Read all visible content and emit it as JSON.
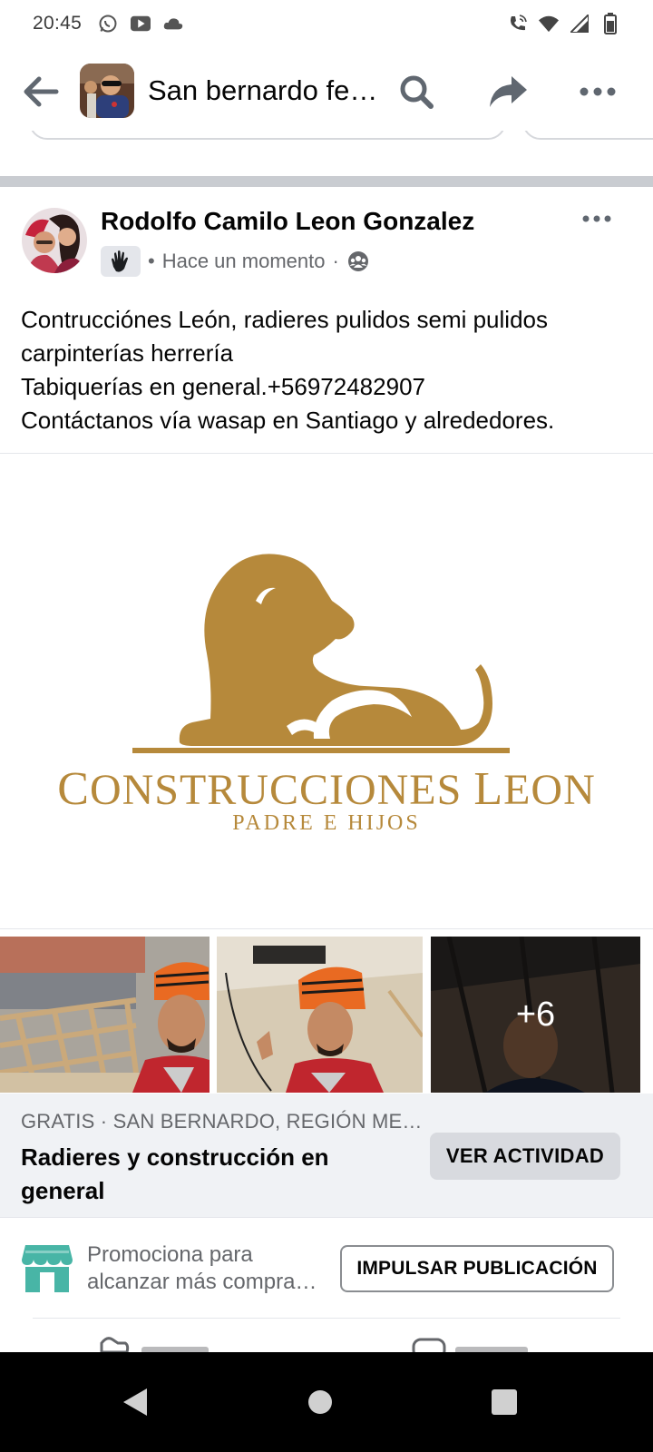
{
  "status_bar": {
    "time": "20:45",
    "left_icons": [
      "whatsapp-icon",
      "youtube-icon",
      "cloud-icon"
    ],
    "right_icons": [
      "wifi-calling-icon",
      "wifi-icon",
      "signal-icon",
      "battery-icon"
    ]
  },
  "header": {
    "title": "San bernardo fe…",
    "icons": [
      "back-arrow-icon",
      "search-icon",
      "share-icon",
      "more-icon"
    ]
  },
  "post": {
    "author": "Rodolfo Camilo Leon Gonzalez",
    "time": "Hace un momento",
    "audience_icon": "group-audience-icon",
    "badge_icon": "hand-badge-icon",
    "text_lines": [
      "Contrucciónes León, radieres pulidos semi pulidos",
      "carpinterías herrería",
      "Tabiquerías en general.+56972482907",
      "Contáctanos vía wasap en Santiago y alrededores."
    ]
  },
  "logo": {
    "name_first_cap": "C",
    "name_first_rest": "ONSTRUCCIONES",
    "name_second_cap": "L",
    "name_second_rest": "EON",
    "tagline": "PADRE E HIJOS",
    "color": "#b6893b"
  },
  "photos": {
    "more_count": "+6"
  },
  "listing": {
    "meta": "GRATIS · SAN BERNARDO, REGIÓN ME…",
    "title": "Radieres y construcción en general",
    "button": "VER ACTIVIDAD"
  },
  "promote": {
    "text_line1": "Promociona para",
    "text_line2": "alcanzar más compra…",
    "button": "IMPULSAR PUBLICACIÓN",
    "icon": "storefront-icon",
    "icon_color": "#48b5a6"
  },
  "nav": {
    "icons": [
      "back-triangle-icon",
      "home-circle-icon",
      "recents-square-icon"
    ]
  }
}
